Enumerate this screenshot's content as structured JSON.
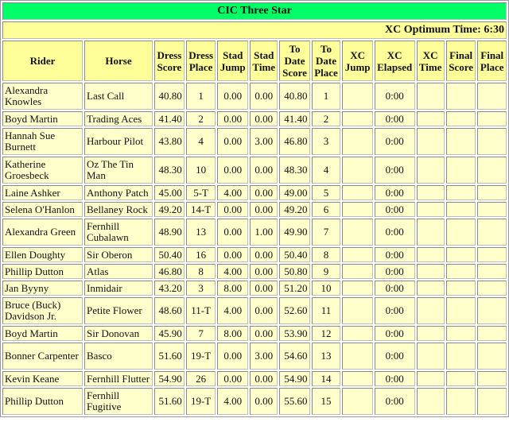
{
  "title": "CIC Three Star",
  "optimum_time_label": "XC Optimum Time: 6:30",
  "headers": [
    "Rider",
    "Horse",
    "Dress Score",
    "Dress Place",
    "Stad Jump",
    "Stad Time",
    "To Date Score",
    "To Date Place",
    "XC Jump",
    "XC Elapsed",
    "XC Time",
    "Final Score",
    "Final Place"
  ],
  "rows": [
    {
      "rider": "Alexandra Knowles",
      "horse": "Last Call",
      "dress_score": "40.80",
      "dress_place": "1",
      "stad_jump": "0.00",
      "stad_time": "0.00",
      "to_date_score": "40.80",
      "to_date_place": "1",
      "xc_jump": "",
      "xc_elapsed": "0:00",
      "xc_time": "",
      "final_score": "",
      "final_place": "",
      "tall": true
    },
    {
      "rider": "Boyd Martin",
      "horse": "Trading Aces",
      "dress_score": "41.40",
      "dress_place": "2",
      "stad_jump": "0.00",
      "stad_time": "0.00",
      "to_date_score": "41.40",
      "to_date_place": "2",
      "xc_jump": "",
      "xc_elapsed": "0:00",
      "xc_time": "",
      "final_score": "",
      "final_place": "",
      "tall": false
    },
    {
      "rider": "Hannah Sue Burnett",
      "horse": "Harbour Pilot",
      "dress_score": "43.80",
      "dress_place": "4",
      "stad_jump": "0.00",
      "stad_time": "3.00",
      "to_date_score": "46.80",
      "to_date_place": "3",
      "xc_jump": "",
      "xc_elapsed": "0:00",
      "xc_time": "",
      "final_score": "",
      "final_place": "",
      "tall": true
    },
    {
      "rider": "Katherine Groesbeck",
      "horse": "Oz The Tin Man",
      "dress_score": "48.30",
      "dress_place": "10",
      "stad_jump": "0.00",
      "stad_time": "0.00",
      "to_date_score": "48.30",
      "to_date_place": "4",
      "xc_jump": "",
      "xc_elapsed": "0:00",
      "xc_time": "",
      "final_score": "",
      "final_place": "",
      "tall": true
    },
    {
      "rider": "Laine Ashker",
      "horse": "Anthony Patch",
      "dress_score": "45.00",
      "dress_place": "5-T",
      "stad_jump": "4.00",
      "stad_time": "0.00",
      "to_date_score": "49.00",
      "to_date_place": "5",
      "xc_jump": "",
      "xc_elapsed": "0:00",
      "xc_time": "",
      "final_score": "",
      "final_place": "",
      "tall": false
    },
    {
      "rider": "Selena O'Hanlon",
      "horse": "Bellaney Rock",
      "dress_score": "49.20",
      "dress_place": "14-T",
      "stad_jump": "0.00",
      "stad_time": "0.00",
      "to_date_score": "49.20",
      "to_date_place": "6",
      "xc_jump": "",
      "xc_elapsed": "0:00",
      "xc_time": "",
      "final_score": "",
      "final_place": "",
      "tall": false
    },
    {
      "rider": "Alexandra Green",
      "horse": "Fernhill Cubalawn",
      "dress_score": "48.90",
      "dress_place": "13",
      "stad_jump": "0.00",
      "stad_time": "1.00",
      "to_date_score": "49.90",
      "to_date_place": "7",
      "xc_jump": "",
      "xc_elapsed": "0:00",
      "xc_time": "",
      "final_score": "",
      "final_place": "",
      "tall": true
    },
    {
      "rider": "Ellen Doughty",
      "horse": "Sir Oberon",
      "dress_score": "50.40",
      "dress_place": "16",
      "stad_jump": "0.00",
      "stad_time": "0.00",
      "to_date_score": "50.40",
      "to_date_place": "8",
      "xc_jump": "",
      "xc_elapsed": "0:00",
      "xc_time": "",
      "final_score": "",
      "final_place": "",
      "tall": false
    },
    {
      "rider": "Phillip Dutton",
      "horse": "Atlas",
      "dress_score": "46.80",
      "dress_place": "8",
      "stad_jump": "4.00",
      "stad_time": "0.00",
      "to_date_score": "50.80",
      "to_date_place": "9",
      "xc_jump": "",
      "xc_elapsed": "0:00",
      "xc_time": "",
      "final_score": "",
      "final_place": "",
      "tall": false
    },
    {
      "rider": "Jan Byyny",
      "horse": "Inmidair",
      "dress_score": "43.20",
      "dress_place": "3",
      "stad_jump": "8.00",
      "stad_time": "0.00",
      "to_date_score": "51.20",
      "to_date_place": "10",
      "xc_jump": "",
      "xc_elapsed": "0:00",
      "xc_time": "",
      "final_score": "",
      "final_place": "",
      "tall": false
    },
    {
      "rider": "Bruce (Buck) Davidson Jr.",
      "horse": "Petite Flower",
      "dress_score": "48.60",
      "dress_place": "11-T",
      "stad_jump": "4.00",
      "stad_time": "0.00",
      "to_date_score": "52.60",
      "to_date_place": "11",
      "xc_jump": "",
      "xc_elapsed": "0:00",
      "xc_time": "",
      "final_score": "",
      "final_place": "",
      "tall": true
    },
    {
      "rider": "Boyd Martin",
      "horse": "Sir Donovan",
      "dress_score": "45.90",
      "dress_place": "7",
      "stad_jump": "8.00",
      "stad_time": "0.00",
      "to_date_score": "53.90",
      "to_date_place": "12",
      "xc_jump": "",
      "xc_elapsed": "0:00",
      "xc_time": "",
      "final_score": "",
      "final_place": "",
      "tall": false
    },
    {
      "rider": "Bonner Carpenter",
      "horse": "Basco",
      "dress_score": "51.60",
      "dress_place": "19-T",
      "stad_jump": "0.00",
      "stad_time": "3.00",
      "to_date_score": "54.60",
      "to_date_place": "13",
      "xc_jump": "",
      "xc_elapsed": "0:00",
      "xc_time": "",
      "final_score": "",
      "final_place": "",
      "tall": true
    },
    {
      "rider": "Kevin Keane",
      "horse": "Fernhill Flutter",
      "dress_score": "54.90",
      "dress_place": "26",
      "stad_jump": "0.00",
      "stad_time": "0.00",
      "to_date_score": "54.90",
      "to_date_place": "14",
      "xc_jump": "",
      "xc_elapsed": "0:00",
      "xc_time": "",
      "final_score": "",
      "final_place": "",
      "tall": false
    },
    {
      "rider": "Phillip Dutton",
      "horse": "Fernhill Fugitive",
      "dress_score": "51.60",
      "dress_place": "19-T",
      "stad_jump": "4.00",
      "stad_time": "0.00",
      "to_date_score": "55.60",
      "to_date_place": "15",
      "xc_jump": "",
      "xc_elapsed": "0:00",
      "xc_time": "",
      "final_score": "",
      "final_place": "",
      "tall": true
    }
  ],
  "colors": {
    "title_bg": "#00ff66",
    "header_bg": "#ffff99",
    "cell_bg": "#ffffcc"
  }
}
